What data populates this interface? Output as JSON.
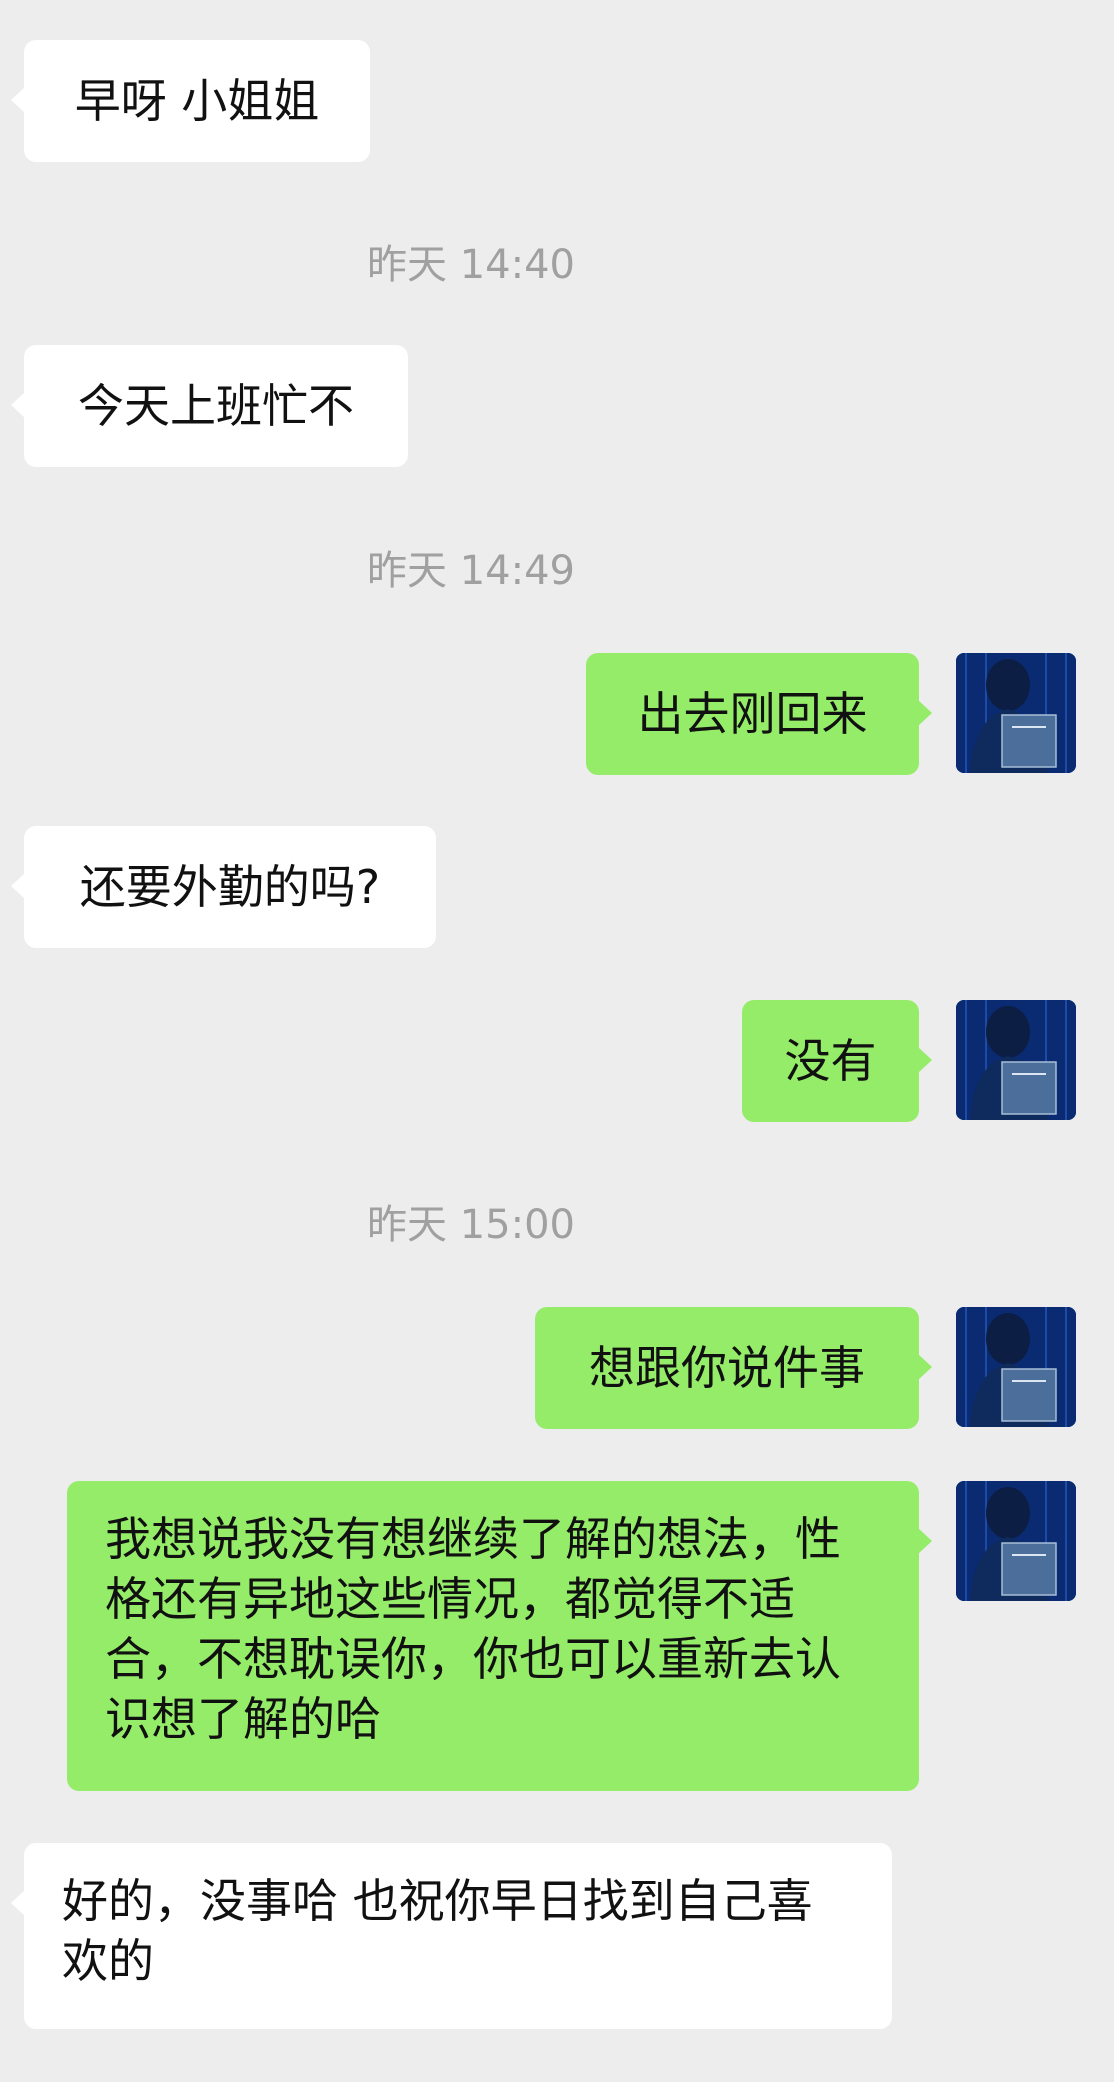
{
  "messages": [
    {
      "type": "in",
      "text": "早呀 小姐姐"
    },
    {
      "type": "time",
      "text": "昨天 14:40"
    },
    {
      "type": "in",
      "text": "今天上班忙不"
    },
    {
      "type": "time",
      "text": "昨天 14:49"
    },
    {
      "type": "out",
      "text": "出去刚回来",
      "avatar": "hooded-figure-reading-book-avatar"
    },
    {
      "type": "in",
      "text": "还要外勤的吗?"
    },
    {
      "type": "out",
      "text": "没有",
      "avatar": "hooded-figure-reading-book-avatar"
    },
    {
      "type": "time",
      "text": "昨天 15:00"
    },
    {
      "type": "out",
      "text": "想跟你说件事",
      "avatar": "hooded-figure-reading-book-avatar"
    },
    {
      "type": "out",
      "text": "我想说我没有想继续了解的想法，性格还有异地这些情况，都觉得不适合，不想耽误你，你也可以重新去认识想了解的哈",
      "avatar": "hooded-figure-reading-book-avatar"
    },
    {
      "type": "in",
      "text": "好的，没事哈 也祝你早日找到自己喜欢的"
    }
  ],
  "colors": {
    "background": "#ededed",
    "incoming_bubble": "#ffffff",
    "outgoing_bubble": "#95ec69",
    "timestamp": "#a0a0a0",
    "avatar": "#0a2a72"
  }
}
